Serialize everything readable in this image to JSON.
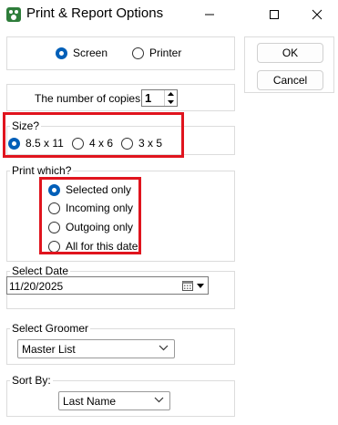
{
  "window": {
    "title": "Print & Report Options",
    "controls": {
      "minimize": "minimize-icon",
      "maximize": "maximize-icon",
      "close": "close-icon"
    }
  },
  "output": {
    "options": [
      {
        "label": "Screen",
        "selected": true
      },
      {
        "label": "Printer",
        "selected": false
      }
    ]
  },
  "buttons": {
    "ok": "OK",
    "cancel": "Cancel"
  },
  "copies": {
    "label": "The number of copies:",
    "value": "1"
  },
  "size": {
    "legend": "Size?",
    "options": [
      {
        "label": "8.5 x 11",
        "selected": true
      },
      {
        "label": "4 x 6",
        "selected": false
      },
      {
        "label": "3 x 5",
        "selected": false
      }
    ]
  },
  "print_which": {
    "legend": "Print which?",
    "options": [
      {
        "label": "Selected only",
        "selected": true
      },
      {
        "label": "Incoming only",
        "selected": false
      },
      {
        "label": "Outgoing only",
        "selected": false
      },
      {
        "label": "All for this date",
        "selected": false
      }
    ]
  },
  "select_date": {
    "legend": "Select Date",
    "value": "11/20/2025"
  },
  "select_groomer": {
    "legend": "Select Groomer",
    "value": "Master List"
  },
  "sort_by": {
    "legend": "Sort By:",
    "value": "Last Name"
  },
  "colors": {
    "accent": "#005fb8",
    "highlight_box": "#e0141e",
    "app_icon": "#2e7d3a"
  }
}
